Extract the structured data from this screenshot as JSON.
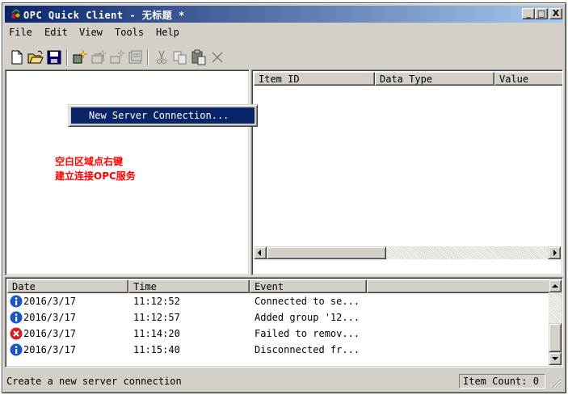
{
  "window": {
    "title": "OPC Quick Client - 无标题 *",
    "controls": [
      "_",
      "□",
      "X"
    ]
  },
  "menu": [
    "File",
    "Edit",
    "View",
    "Tools",
    "Help"
  ],
  "toolbar": {
    "buttons": [
      "new-file-icon",
      "open-folder-icon",
      "save-icon",
      "new-server-icon",
      "new-group-icon",
      "new-item-icon",
      "properties-icon",
      "cut-icon",
      "copy-icon",
      "paste-icon",
      "delete-icon"
    ]
  },
  "context_menu": {
    "items": [
      "New Server Connection..."
    ]
  },
  "annotation": {
    "line1": "空白区域点右键",
    "line2": "建立连接OPC服务",
    "color": "#ff0000"
  },
  "item_list": {
    "columns": [
      "Item ID",
      "Data Type",
      "Value"
    ]
  },
  "log": {
    "columns": [
      "Date",
      "Time",
      "Event"
    ],
    "rows": [
      {
        "icon": "info-icon",
        "date": "2016/3/17",
        "time": "11:12:52",
        "event": "Connected to se..."
      },
      {
        "icon": "info-icon",
        "date": "2016/3/17",
        "time": "11:12:57",
        "event": "Added group '12..."
      },
      {
        "icon": "error-icon",
        "date": "2016/3/17",
        "time": "11:14:20",
        "event": "Failed to remov..."
      },
      {
        "icon": "info-icon",
        "date": "2016/3/17",
        "time": "11:15:40",
        "event": "Disconnected fr..."
      }
    ]
  },
  "status": {
    "text": "Create a new server connection",
    "item_count": "Item Count: 0"
  },
  "colors": {
    "titlebar_start": "#0a246a",
    "titlebar_end": "#a6caf0",
    "highlight": "#0a246a",
    "face": "#d4d0c8",
    "info": "#1a56c4",
    "error": "#d42020"
  }
}
